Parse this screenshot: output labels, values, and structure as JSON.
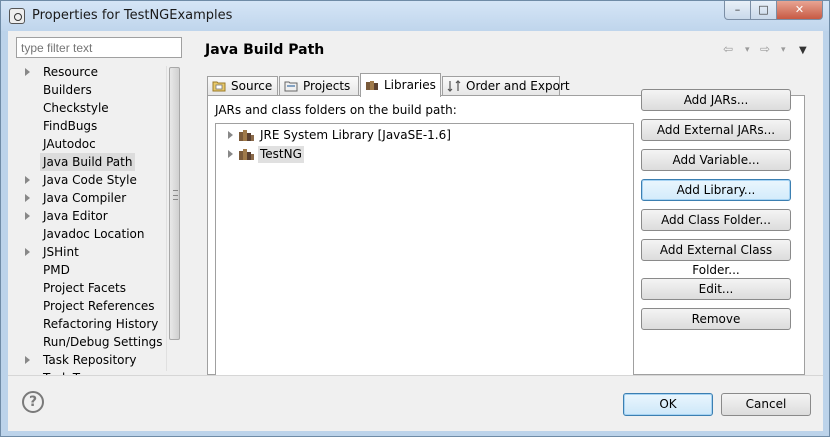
{
  "window": {
    "title": "Properties for TestNGExamples",
    "minimize_glyph": "–",
    "maximize_glyph": "□",
    "close_glyph": "✕"
  },
  "filter": {
    "placeholder": "type filter text"
  },
  "tree": {
    "items": [
      {
        "label": "Resource",
        "expandable": true
      },
      {
        "label": "Builders",
        "expandable": false
      },
      {
        "label": "Checkstyle",
        "expandable": false
      },
      {
        "label": "FindBugs",
        "expandable": false
      },
      {
        "label": "JAutodoc",
        "expandable": false
      },
      {
        "label": "Java Build Path",
        "expandable": false,
        "selected": true
      },
      {
        "label": "Java Code Style",
        "expandable": true
      },
      {
        "label": "Java Compiler",
        "expandable": true
      },
      {
        "label": "Java Editor",
        "expandable": true
      },
      {
        "label": "Javadoc Location",
        "expandable": false
      },
      {
        "label": "JSHint",
        "expandable": true
      },
      {
        "label": "PMD",
        "expandable": false
      },
      {
        "label": "Project Facets",
        "expandable": false
      },
      {
        "label": "Project References",
        "expandable": false
      },
      {
        "label": "Refactoring History",
        "expandable": false
      },
      {
        "label": "Run/Debug Settings",
        "expandable": false
      },
      {
        "label": "Task Repository",
        "expandable": true
      },
      {
        "label": "Task Tags",
        "expandable": false
      }
    ]
  },
  "page": {
    "title": "Java Build Path",
    "nav": {
      "back": "⇦",
      "forward": "⇨",
      "dropdown": "▾",
      "menu": "▼"
    }
  },
  "tabs": [
    {
      "label": "Source",
      "icon": "source-folder-icon"
    },
    {
      "label": "Projects",
      "icon": "projects-icon"
    },
    {
      "label": "Libraries",
      "icon": "library-icon",
      "active": true
    },
    {
      "label": "Order and Export",
      "icon": "order-export-icon"
    }
  ],
  "libraries": {
    "label": "JARs and class folders on the build path:",
    "entries": [
      {
        "label": "JRE System Library [JavaSE-1.6]",
        "icon": "library-icon"
      },
      {
        "label": "TestNG",
        "icon": "library-icon",
        "selected": true
      }
    ],
    "buttons": [
      "Add JARs...",
      "Add External JARs...",
      "Add Variable...",
      "Add Library...",
      "Add Class Folder...",
      "Add External Class Folder...",
      "Edit...",
      "Remove"
    ]
  },
  "dialog": {
    "help": "?",
    "ok_label": "OK",
    "cancel_label": "Cancel"
  },
  "colors": {
    "window_frame": "#bcd3ea",
    "focus_border": "#3c7fb1",
    "selection": "#dcdcdc"
  }
}
